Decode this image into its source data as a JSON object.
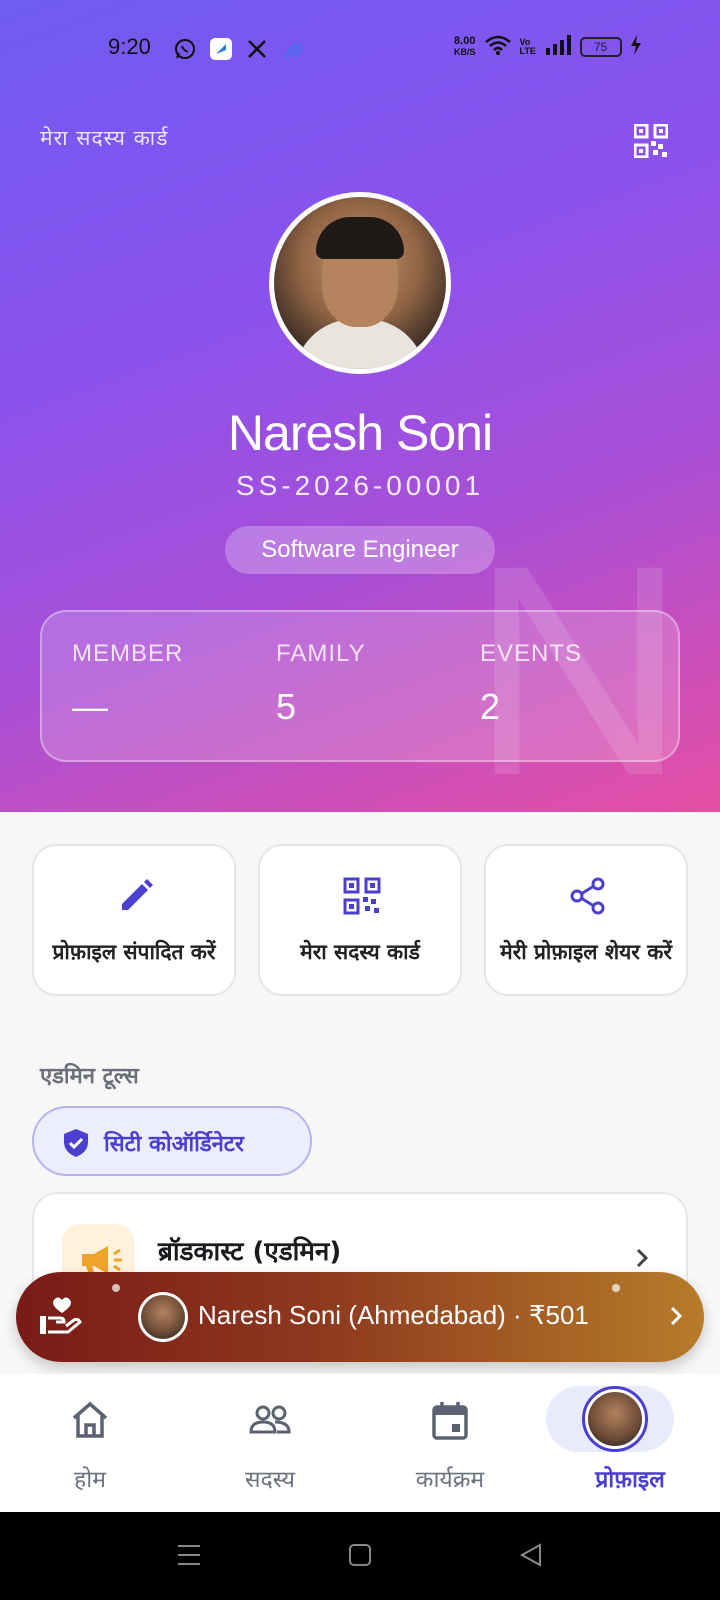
{
  "status_bar": {
    "time": "9:20",
    "net_speed_value": "8.00",
    "net_speed_unit": "KB/S",
    "volte": "Vo LTE",
    "battery": "75"
  },
  "header": {
    "title": "मेरा सदस्य कार्ड",
    "qr_icon": "qr-code-icon"
  },
  "profile": {
    "name": "Naresh Soni",
    "member_id": "SS-2026-00001",
    "role": "Software Engineer",
    "watermark_letter": "N"
  },
  "stats": [
    {
      "label": "MEMBER",
      "value": "—"
    },
    {
      "label": "FAMILY",
      "value": "5"
    },
    {
      "label": "EVENTS",
      "value": "2"
    }
  ],
  "actions": [
    {
      "label": "प्रोफ़ाइल संपादित करें",
      "icon": "pencil-icon"
    },
    {
      "label": "मेरा सदस्य कार्ड",
      "icon": "qr-code-icon"
    },
    {
      "label": "मेरी प्रोफ़ाइल शेयर करें",
      "icon": "share-icon"
    }
  ],
  "admin": {
    "section_title": "एडमिन टूल्स",
    "role_badge": "सिटी कोऑर्डिनेटर",
    "broadcast_title": "ब्रॉडकास्ट (एडमिन)"
  },
  "donation": {
    "text": "Naresh Soni (Ahmedabad) · ₹501"
  },
  "bottom_nav": [
    {
      "label": "होम",
      "icon": "home-icon"
    },
    {
      "label": "सदस्य",
      "icon": "members-icon"
    },
    {
      "label": "कार्यक्रम",
      "icon": "calendar-icon"
    },
    {
      "label": "प्रोफ़ाइल",
      "icon": "profile-avatar-icon"
    }
  ],
  "colors": {
    "accent": "#4b3fd1",
    "gradient_start": "#6f5cf0",
    "gradient_end": "#e64fa4",
    "donation_start": "#7a1a17",
    "donation_end": "#b67c2a"
  }
}
